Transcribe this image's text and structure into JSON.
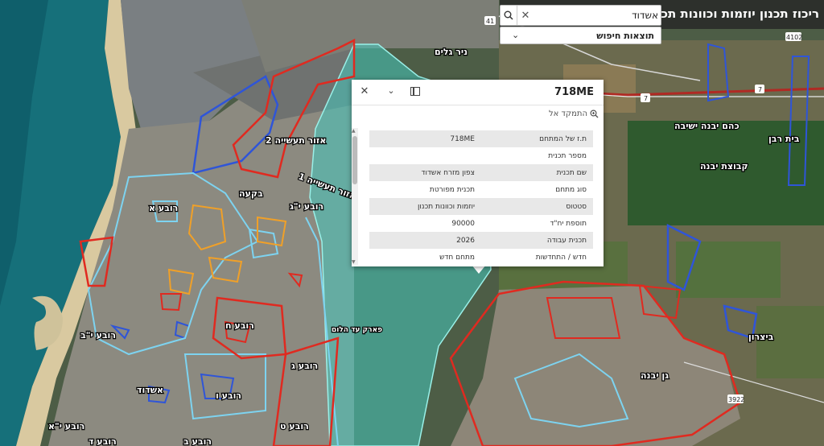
{
  "header": {
    "title": "ריכוז תכנון יוזמות וכוונות תכנון"
  },
  "search": {
    "value": "אשדוד",
    "placeholder": ""
  },
  "results_dropdown": {
    "label": "תוצאות חיפוש"
  },
  "popup": {
    "title": "718ME",
    "zoom_label": "התמקד אל",
    "rows": [
      {
        "key": "ת.ז של המתחם",
        "value": "718ME"
      },
      {
        "key": "מספר תכנית",
        "value": ""
      },
      {
        "key": "שם תכנית",
        "value": "צפון מזרח אשדוד"
      },
      {
        "key": "סוג מתחם",
        "value": "תכנית מפורטת"
      },
      {
        "key": "סטטוס",
        "value": "יוזמות וכוונות תכנון"
      },
      {
        "key": "תוספת יח\"ד",
        "value": "90000"
      },
      {
        "key": "תכנית עבודה",
        "value": "2026"
      },
      {
        "key": "חדש / התחדשות",
        "value": "מתחם חדש"
      }
    ]
  },
  "map_labels": [
    {
      "id": "ezor-taasia-2",
      "text": "אזור תעשייה 2"
    },
    {
      "id": "ezor-taasia-1",
      "text": "אזור תעשייה 1"
    },
    {
      "id": "bikaa",
      "text": "בקעה"
    },
    {
      "id": "rova-alef",
      "text": "רובע א"
    },
    {
      "id": "rova-vav",
      "text": "רובע ו"
    },
    {
      "id": "rova-yod-alef",
      "text": "רובע י\"א"
    },
    {
      "id": "rova-tet",
      "text": "רובע ט"
    },
    {
      "id": "rova-gimel",
      "text": "רובע ג"
    },
    {
      "id": "ashdod",
      "text": "אשדוד"
    },
    {
      "id": "rova-het",
      "text": "רובע ח"
    },
    {
      "id": "rova-bet",
      "text": "רובע ב"
    },
    {
      "id": "rova-dalet",
      "text": "רובע ד"
    },
    {
      "id": "rova-yod-gimel",
      "text": "רובע י\"ג"
    },
    {
      "id": "rova-yod-bet",
      "text": "רובע י\"ב"
    },
    {
      "id": "park-ad-halom",
      "text": "פארק עד הלום"
    },
    {
      "id": "kfar-ganim",
      "text": "ניר גלים"
    },
    {
      "id": "kahem-yavne",
      "text": "כהם יבנה ישיבה"
    },
    {
      "id": "beit-raban",
      "text": "בית רבן"
    },
    {
      "id": "kvutzat-yavne",
      "text": "קבוצת יבנה"
    },
    {
      "id": "gan-yavne",
      "text": "גן יבנה"
    },
    {
      "id": "bitzaron",
      "text": "ביצרון"
    },
    {
      "id": "rd-41",
      "text": "41"
    },
    {
      "id": "rd-7",
      "text": "7"
    },
    {
      "id": "rd-3922",
      "text": "3922"
    },
    {
      "id": "rd-4102",
      "text": "4102"
    }
  ]
}
